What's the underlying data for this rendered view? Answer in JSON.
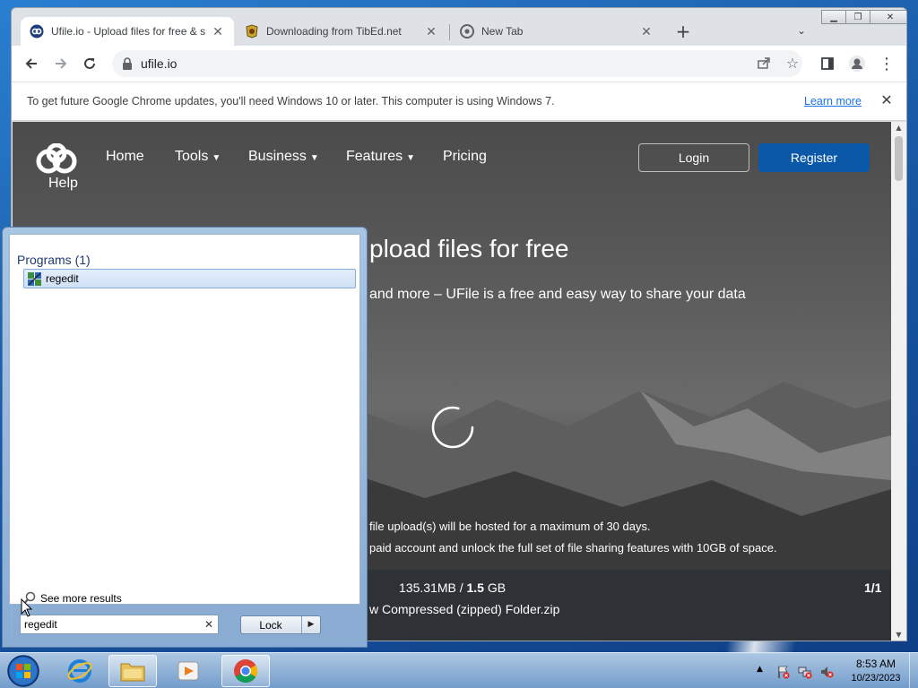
{
  "browser": {
    "tabs": [
      {
        "title": "Ufile.io - Upload files for free & s",
        "active": true
      },
      {
        "title": "Downloading from TibEd.net",
        "active": false
      },
      {
        "title": "New Tab",
        "active": false
      }
    ],
    "url": "ufile.io",
    "infobar": {
      "message": "To get future Google Chrome updates, you'll need Windows 10 or later. This computer is using Windows 7.",
      "link": "Learn more"
    }
  },
  "site": {
    "logo_text": "Help",
    "nav": [
      {
        "label": "Home",
        "dropdown": false
      },
      {
        "label": "Tools",
        "dropdown": true
      },
      {
        "label": "Business",
        "dropdown": true
      },
      {
        "label": "Features",
        "dropdown": true
      },
      {
        "label": "Pricing",
        "dropdown": false
      }
    ],
    "login": "Login",
    "register": "Register",
    "hero_title": "pload files for free",
    "hero_sub": "and more – UFile is a free and easy way to share your data",
    "note1": "file upload(s) will be hosted for a maximum of 30 days.",
    "note2": "paid account and unlock the full set of file sharing features with 10GB of space.",
    "quota_used": "135.31MB",
    "quota_sep": " / ",
    "quota_total": "1.5",
    "quota_unit": " GB",
    "counter": "1/1",
    "filename": "w Compressed (zipped) Folder.zip"
  },
  "startmenu": {
    "heading": "Programs (1)",
    "result": "regedit",
    "see_more": "See more results",
    "search_value": "regedit",
    "lock_label": "Lock"
  },
  "taskbar": {
    "time": "8:53 AM",
    "date": "10/23/2023"
  },
  "colors": {
    "register_bg": "#0c58a8",
    "link": "#1a73e8",
    "upload_bar": "#2e3136"
  }
}
